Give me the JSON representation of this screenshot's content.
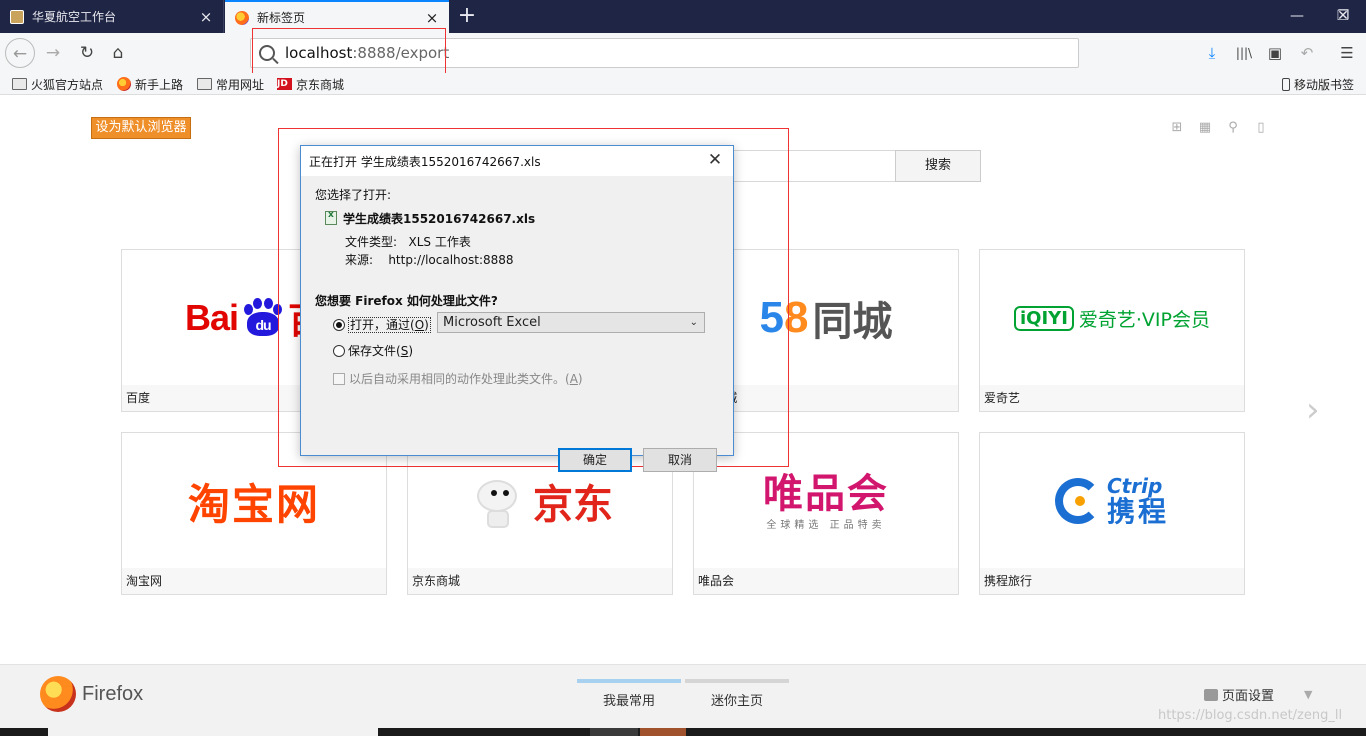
{
  "tabs": [
    {
      "title": "华夏航空工作台",
      "close": "×"
    },
    {
      "title": "新标签页",
      "close": "×"
    }
  ],
  "new_tab": "+",
  "window_controls": {
    "minimize": "—",
    "maximize": "❐",
    "close": "✕"
  },
  "nav": {
    "back": "←",
    "forward": "→",
    "reload": "↻",
    "home": "⌂",
    "url_host": "localhost",
    "url_rest": ":8888/export",
    "download": "⤓",
    "library": "|||\\",
    "sidebar": "▣",
    "undo": "↶",
    "menu": "☰"
  },
  "bookmarks": {
    "items": [
      {
        "label": "火狐官方站点"
      },
      {
        "label": "新手上路"
      },
      {
        "label": "常用网址"
      },
      {
        "label": "京东商城"
      }
    ],
    "jd_mark": "JD",
    "mobile": "移动版书签"
  },
  "content": {
    "default_browser": "设为默认浏览器",
    "search_button": "搜索",
    "tiles": [
      {
        "label": "百度"
      },
      {
        "label": "58同城"
      },
      {
        "label": "爱奇艺"
      },
      {
        "label": "淘宝网"
      },
      {
        "label": "京东商城"
      },
      {
        "label": "唯品会"
      },
      {
        "label": "携程旅行"
      }
    ],
    "logos": {
      "baidu_a": "Bai",
      "baidu_paw": "du",
      "baidu_b": "百",
      "fiveeight_5": "5",
      "fiveeight_8": "8",
      "fiveeight_cn": "同城",
      "iqiyi_mark": "iQIYI",
      "iqiyi_text": "爱奇艺·VIP会员",
      "taobao": "淘宝网",
      "jd": "京东",
      "vip_big": "唯品会",
      "vip_small": "全球精选 正品特卖",
      "ctrip_en": "Ctrip",
      "ctrip_zh": "携程"
    },
    "next_arrow": "›"
  },
  "dialog": {
    "title": "正在打开 学生成绩表1552016742667.xls",
    "close": "✕",
    "chosen": "您选择了打开:",
    "filename": "学生成绩表1552016742667.xls",
    "type_label": "文件类型:",
    "type_value": "XLS 工作表",
    "source_label": "来源:",
    "source_value": "http://localhost:8888",
    "question": "您想要 Firefox 如何处理此文件?",
    "open_with": "打开，通过(",
    "open_with_key": "O",
    "open_with_end": ")",
    "app": "Microsoft Excel",
    "save_file": "保存文件(",
    "save_file_key": "S",
    "save_file_end": ")",
    "auto_text": "以后自动采用相同的动作处理此类文件。(",
    "auto_key": "A",
    "auto_end": ")",
    "ok": "确定",
    "cancel": "取消"
  },
  "footer": {
    "brand": "Firefox",
    "tab_frequent": "我最常用",
    "tab_mini": "迷你主页",
    "page_settings": "页面设置",
    "caret": "▼"
  },
  "watermark": "https://blog.csdn.net/zeng_ll"
}
